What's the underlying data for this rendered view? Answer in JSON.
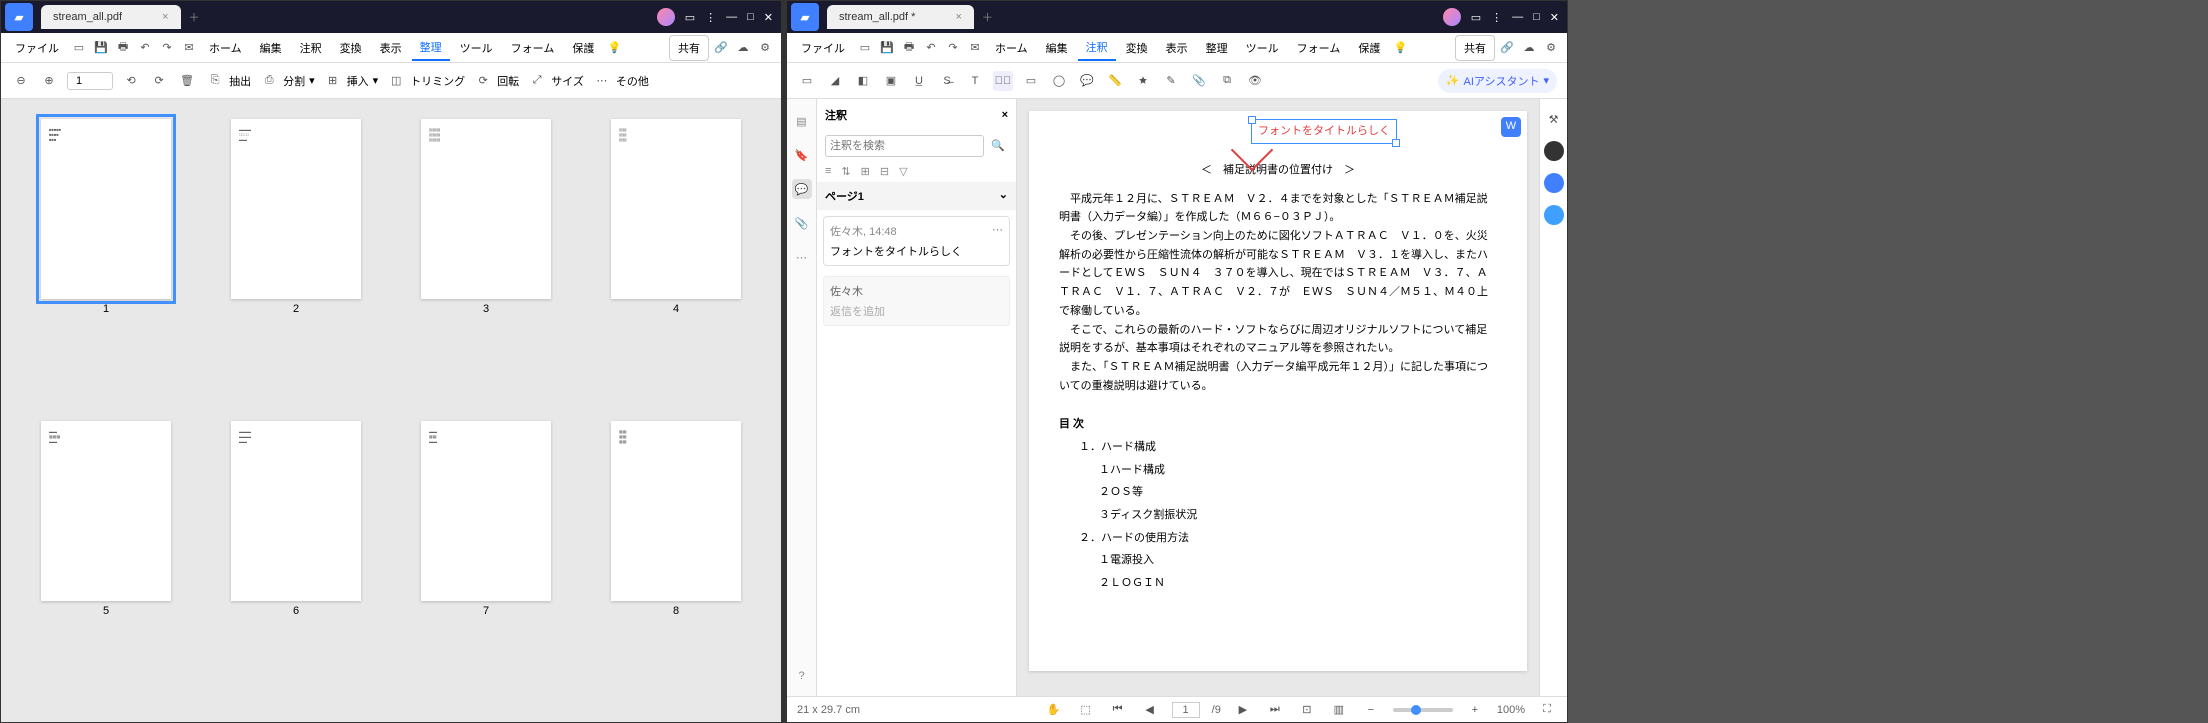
{
  "left": {
    "tab": "stream_all.pdf",
    "menus": {
      "file": "ファイル",
      "home": "ホーム",
      "edit": "編集",
      "annot": "注釈",
      "convert": "変換",
      "view": "表示",
      "organize": "整理",
      "tool": "ツール",
      "form": "フォーム",
      "protect": "保護"
    },
    "share": "共有",
    "page_input": "1",
    "tools": {
      "extract": "抽出",
      "split": "分割",
      "insert": "挿入",
      "trim": "トリミング",
      "rotate": "回転",
      "size": "サイズ",
      "other": "その他"
    },
    "thumbs": [
      "1",
      "2",
      "3",
      "4",
      "5",
      "6",
      "7",
      "8"
    ]
  },
  "right": {
    "tab": "stream_all.pdf *",
    "menus": {
      "file": "ファイル",
      "home": "ホーム",
      "edit": "編集",
      "annot": "注釈",
      "convert": "変換",
      "view": "表示",
      "organize": "整理",
      "tool": "ツール",
      "form": "フォーム",
      "protect": "保護"
    },
    "share": "共有",
    "ai": "AIアシスタント",
    "panel": {
      "title": "注釈",
      "search_ph": "注釈を検索",
      "page": "ページ1",
      "author": "佐々木",
      "time": "14:48",
      "text": "フォントをタイトルらしく",
      "reply_author": "佐々木",
      "reply_ph": "返信を追加"
    },
    "doc": {
      "callout": "フォントをタイトルらしく",
      "heading": "＜　補足説明書の位置付け　＞",
      "p1": "　平成元年１２月に、ＳＴＲＥＡＭ　Ｖ２．４までを対象とした「ＳＴＲＥＡＭ補足説明書（入力データ編）」を作成した（Ｍ６６−０３ＰＪ）。",
      "p2": "　その後、プレゼンテーション向上のために図化ソフトＡＴＲＡＣ　Ｖ１．０を、火災解析の必要性から圧縮性流体の解析が可能なＳＴＲＥＡＭ　Ｖ３．１を導入し、またハードとしてＥＷＳ　ＳＵＮ４　３７０を導入し、現在ではＳＴＲＥＡＭ　Ｖ３．７、ＡＴＲＡＣ　Ｖ１．７、ＡＴＲＡＣ　Ｖ２．７が　ＥＷＳ　ＳＵＮ４／Ｍ５１、Ｍ４０上で稼働している。",
      "p3": "　そこで、これらの最新のハード・ソフトならびに周辺オリジナルソフトについて補足説明をするが、基本事項はそれぞれのマニュアル等を参照されたい。",
      "p4": "　また、「ＳＴＲＥＡＭ補足説明書（入力データ編平成元年１２月）」に記した事項についての重複説明は避けている。",
      "toc_h": "目 次",
      "t1": "１．ハード構成",
      "t11": "１ハード構成",
      "t12": "２ＯＳ等",
      "t13": "３ディスク割振状況",
      "t2": "２．ハードの使用方法",
      "t21": "１電源投入",
      "t22": "２ＬＯＧＩＮ"
    },
    "status": {
      "dim": "21 x 29.7 cm",
      "page": "1",
      "total": "/9",
      "zoom": "100%"
    }
  }
}
